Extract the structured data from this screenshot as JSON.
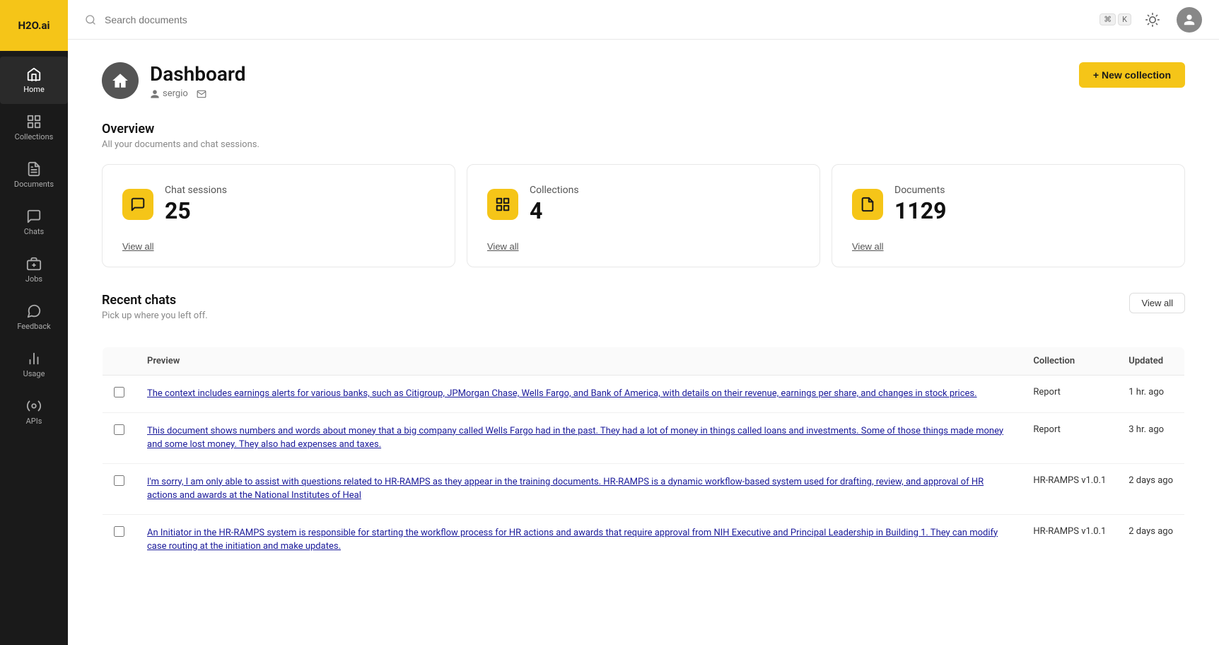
{
  "app": {
    "logo": "H2O.ai"
  },
  "search": {
    "placeholder": "Search documents",
    "kbd1": "⌘",
    "kbd2": "K"
  },
  "sidebar": {
    "items": [
      {
        "id": "home",
        "label": "Home",
        "active": true
      },
      {
        "id": "collections",
        "label": "Collections",
        "active": false
      },
      {
        "id": "documents",
        "label": "Documents",
        "active": false
      },
      {
        "id": "chats",
        "label": "Chats",
        "active": false
      },
      {
        "id": "jobs",
        "label": "Jobs",
        "active": false
      },
      {
        "id": "feedback",
        "label": "Feedback",
        "active": false
      },
      {
        "id": "usage",
        "label": "Usage",
        "active": false
      },
      {
        "id": "apis",
        "label": "APIs",
        "active": false
      }
    ]
  },
  "dashboard": {
    "title": "Dashboard",
    "username": "sergio",
    "new_collection_label": "+ New collection"
  },
  "overview": {
    "title": "Overview",
    "subtitle": "All your documents and chat sessions.",
    "stats": [
      {
        "label": "Chat sessions",
        "value": "25",
        "view_all": "View all"
      },
      {
        "label": "Collections",
        "value": "4",
        "view_all": "View all"
      },
      {
        "label": "Documents",
        "value": "1129",
        "view_all": "View all"
      }
    ]
  },
  "recent_chats": {
    "title": "Recent chats",
    "subtitle": "Pick up where you left off.",
    "view_all": "View all",
    "columns": {
      "preview": "Preview",
      "collection": "Collection",
      "updated": "Updated"
    },
    "rows": [
      {
        "preview": "The context includes earnings alerts for various banks, such as Citigroup, JPMorgan Chase, Wells Fargo, and Bank of America, with details on their revenue, earnings per share, and changes in stock prices.",
        "collection": "Report",
        "updated": "1 hr. ago"
      },
      {
        "preview": "This document shows numbers and words about money that a big company called Wells Fargo had in the past. They had a lot of money in things called loans and investments. Some of those things made money and some lost money. They also had expenses and taxes.",
        "collection": "Report",
        "updated": "3 hr. ago"
      },
      {
        "preview": "I'm sorry, I am only able to assist with questions related to HR-RAMPS as they appear in the training documents. HR-RAMPS is a dynamic workflow-based system used for drafting, review, and approval of HR actions and awards at the National Institutes of Heal",
        "collection": "HR-RAMPS v1.0.1",
        "updated": "2 days ago"
      },
      {
        "preview": "An Initiator in the HR-RAMPS system is responsible for starting the workflow process for HR actions and awards that require approval from NIH Executive and Principal Leadership in Building 1. They can modify case routing at the initiation and make updates.",
        "collection": "HR-RAMPS v1.0.1",
        "updated": "2 days ago"
      }
    ]
  }
}
